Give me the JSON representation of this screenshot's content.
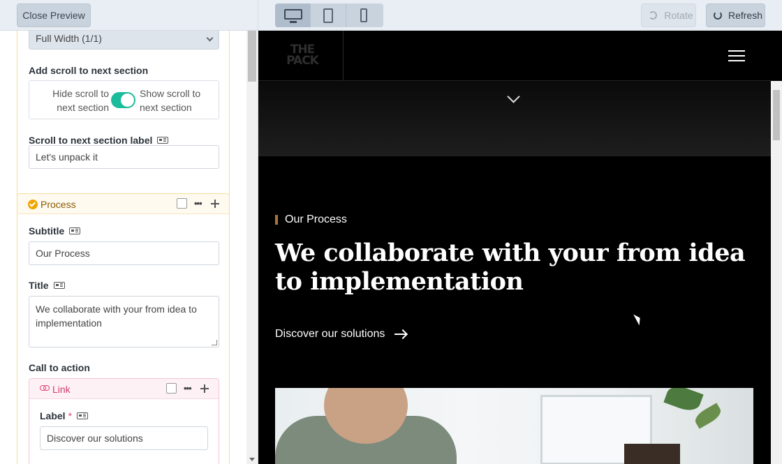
{
  "toolbar": {
    "close_preview": "Close Preview",
    "rotate": "Rotate",
    "refresh": "Refresh",
    "devices": [
      "desktop-icon",
      "tablet-icon",
      "mobile-icon"
    ],
    "active_device": "desktop"
  },
  "editor": {
    "width_select": "Full Width (1/1)",
    "scroll_section": {
      "label": "Add scroll to next section",
      "hide_label": "Hide scroll to next section",
      "show_label": "Show scroll to next section",
      "enabled": true
    },
    "scroll_label": {
      "label": "Scroll to next section label",
      "value": "Let's unpack it"
    },
    "process_block": {
      "title": "Process",
      "subtitle_label": "Subtitle",
      "subtitle_value": "Our Process",
      "title_label": "Title",
      "title_value": "We collaborate with your from idea to implementation",
      "cta_label": "Call to action",
      "link_block": {
        "title": "Link",
        "label_label": "Label",
        "required_mark": "*",
        "label_value": "Discover our solutions"
      }
    }
  },
  "preview": {
    "logo": "THE PACK",
    "subtitle": "Our Process",
    "title": "We collaborate with your from idea to implementation",
    "cta": "Discover our solutions"
  },
  "colors": {
    "accent_toggle": "#1abc9c",
    "process_accent": "#f0a500",
    "link_accent": "#e0457b",
    "preview_bg": "#000000",
    "subtitle_bar": "#a8753a"
  }
}
